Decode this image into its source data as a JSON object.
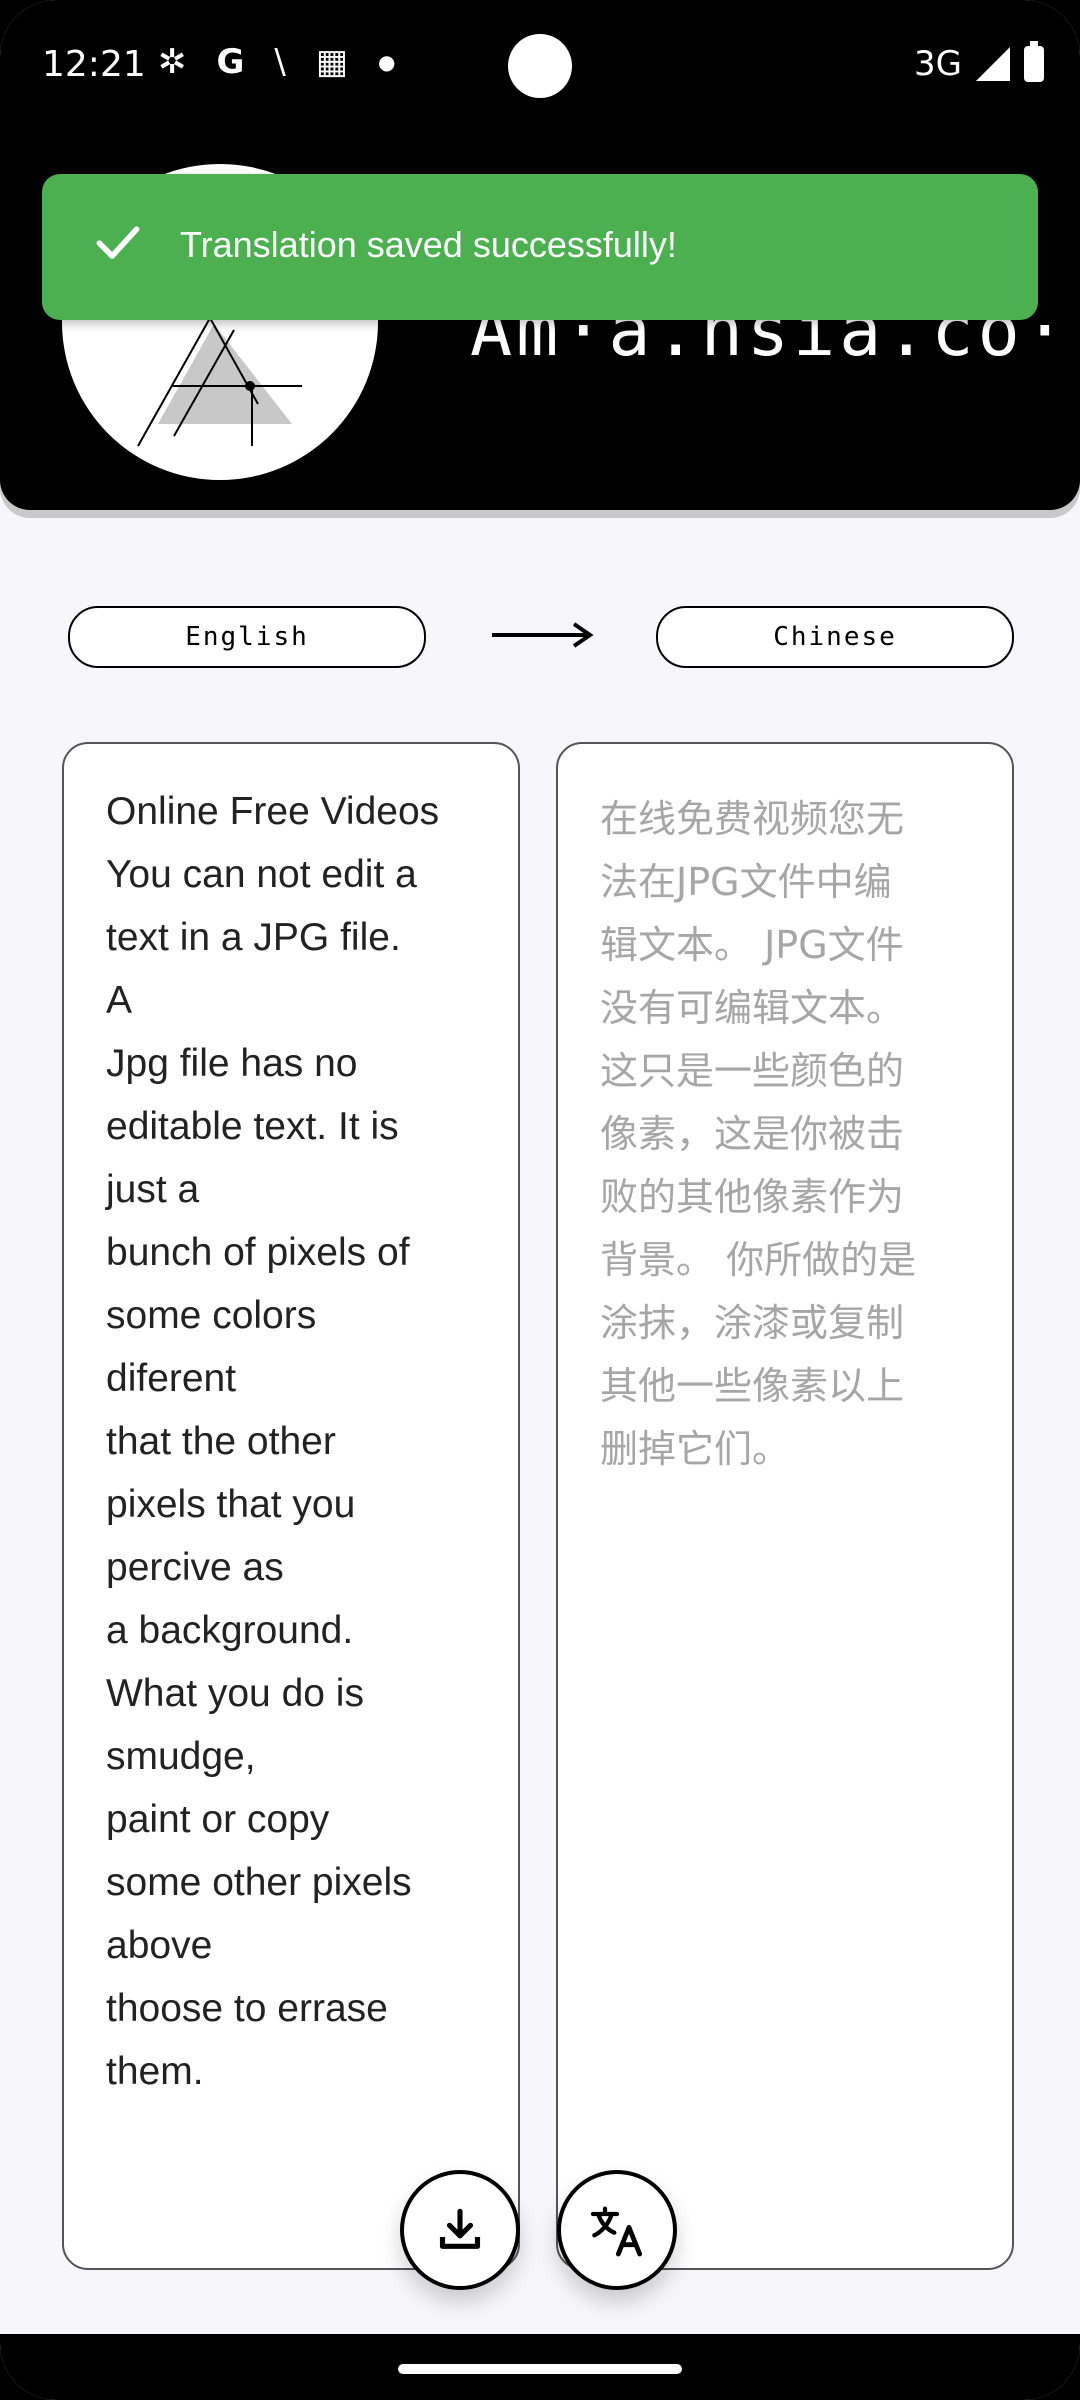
{
  "status_bar": {
    "time": "12:21",
    "network": "3G",
    "icons": [
      "pinwheel-icon",
      "google-icon",
      "slash-icon",
      "calendar-icon",
      "dot-icon",
      "signal-icon",
      "battery-icon"
    ]
  },
  "header": {
    "brand_text": "Am·a.nsia.co·",
    "logo": "app-logo"
  },
  "toast": {
    "message": "Translation saved successfully!",
    "color": "#4caf50"
  },
  "languages": {
    "source": "English",
    "target": "Chinese"
  },
  "source_panel": {
    "text": "Online Free Videos\nYou can not edit a\ntext in a JPG file.\nA\nJpg file has no\neditable text. It is\njust a\nbunch of pixels of\nsome colors\ndiferent\nthat the other\npixels that you\npercive as\na background.\nWhat you do is\nsmudge,\npaint or copy\nsome other pixels\nabove\nthoose to errase\nthem."
  },
  "target_panel": {
    "text": "在线免费视频您无\n法在JPG文件中编\n辑文本。 JPG文件\n没有可编辑文本。\n这只是一些颜色的\n像素，这是你被击\n败的其他像素作为\n背景。 你所做的是\n涂抹，涂漆或复制\n其他一些像素以上\n删掉它们。"
  },
  "actions": {
    "save_icon": "download-icon",
    "translate_icon": "translate-icon"
  }
}
